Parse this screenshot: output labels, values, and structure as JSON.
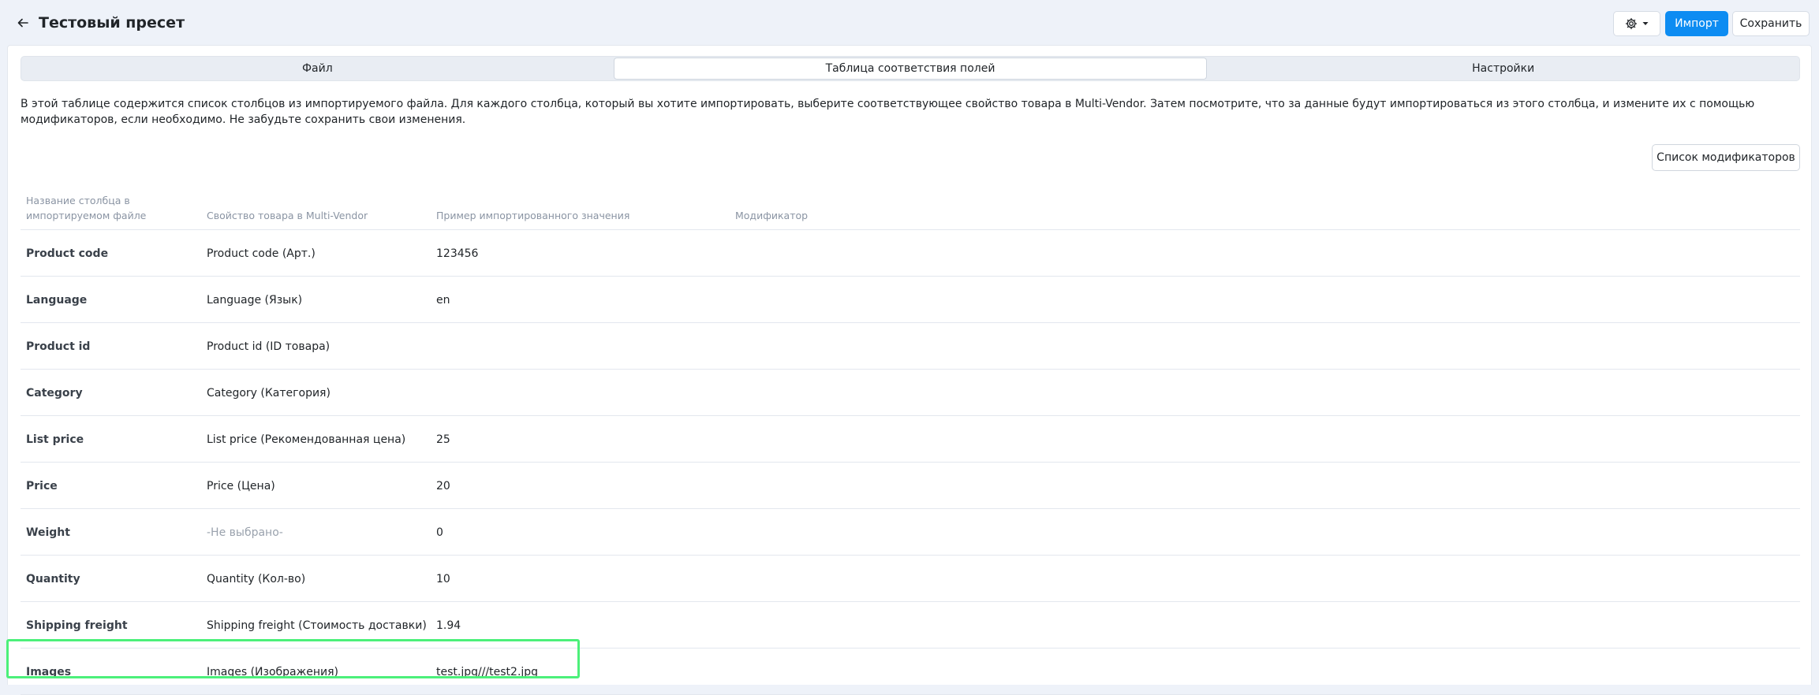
{
  "header": {
    "title": "Тестовый пресет",
    "import_label": "Импорт",
    "save_label": "Сохранить",
    "icons": {
      "back": "arrow-left-icon",
      "settings": "gear-icon",
      "caret": "caret-down-icon"
    }
  },
  "tabs": [
    {
      "label": "Файл",
      "active": false
    },
    {
      "label": "Таблица соответствия полей",
      "active": true
    },
    {
      "label": "Настройки",
      "active": false
    }
  ],
  "intro_text": "В этой таблице содержится список столбцов из импортируемого файла. Для каждого столбца, который вы хотите импортировать, выберите соответствующее свойство товара в Multi-Vendor. Затем посмотрите, что за данные будут импортироваться из этого столбца, и измените их с помощью модификаторов, если необходимо. Не забудьте сохранить свои изменения.",
  "modifiers_button": "Список модификаторов",
  "table": {
    "headers": {
      "column_name": "Название столбца в импортируемом файле",
      "property": "Свойство товара в Multi-Vendor",
      "example": "Пример импортированного значения",
      "modifier": "Модификатор"
    },
    "rows": [
      {
        "column": "Product code",
        "property": "Product code (Арт.)",
        "example": "123456"
      },
      {
        "column": "Language",
        "property": "Language (Язык)",
        "example": "en"
      },
      {
        "column": "Product id",
        "property": "Product id (ID товара)",
        "example": ""
      },
      {
        "column": "Category",
        "property": "Category (Категория)",
        "example": ""
      },
      {
        "column": "List price",
        "property": "List price (Рекомендованная цена)",
        "example": "25"
      },
      {
        "column": "Price",
        "property": "Price (Цена)",
        "example": "20"
      },
      {
        "column": "Weight",
        "property": "-Не выбрано-",
        "example": "0"
      },
      {
        "column": "Quantity",
        "property": "Quantity (Кол-во)",
        "example": "10"
      },
      {
        "column": "Shipping freight",
        "property": "Shipping freight (Стоимость доставки)",
        "example": "1.94"
      },
      {
        "column": "Images",
        "property": "Images (Изображения)",
        "example": "test.jpg///test2.jpg"
      }
    ]
  },
  "colors": {
    "accent": "#0d8cf2",
    "highlight": "#4cf07a",
    "background": "#eef2f9"
  }
}
